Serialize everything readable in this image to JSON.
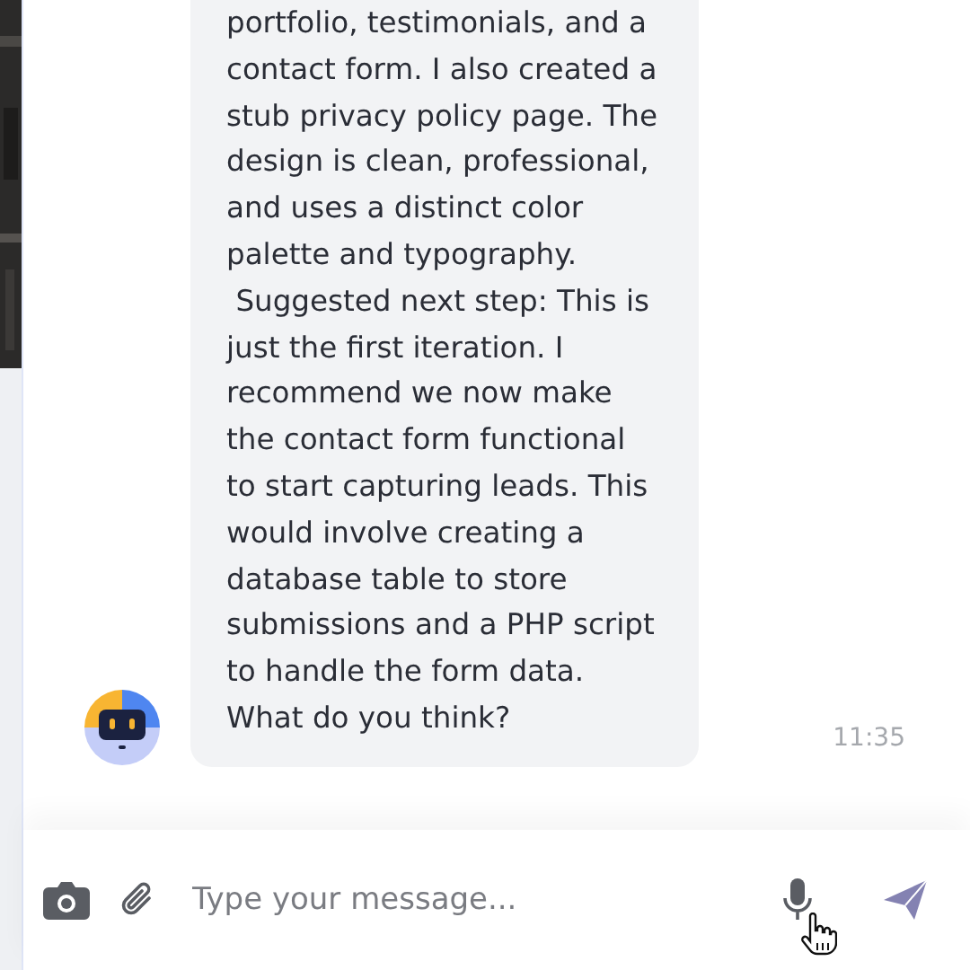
{
  "message": {
    "text": "portfolio, testimonials, and a contact form. I also created a stub privacy policy page. The design is clean, professional, and uses a distinct color palette and typography.\n Suggested next step: This is just the first iteration. I recommend we now make the contact form functional to start capturing leads. This would involve creating a database table to store submissions and a PHP script to handle the form data. What do you think?",
    "time": "11:35"
  },
  "composer": {
    "placeholder": "Type your message..."
  }
}
